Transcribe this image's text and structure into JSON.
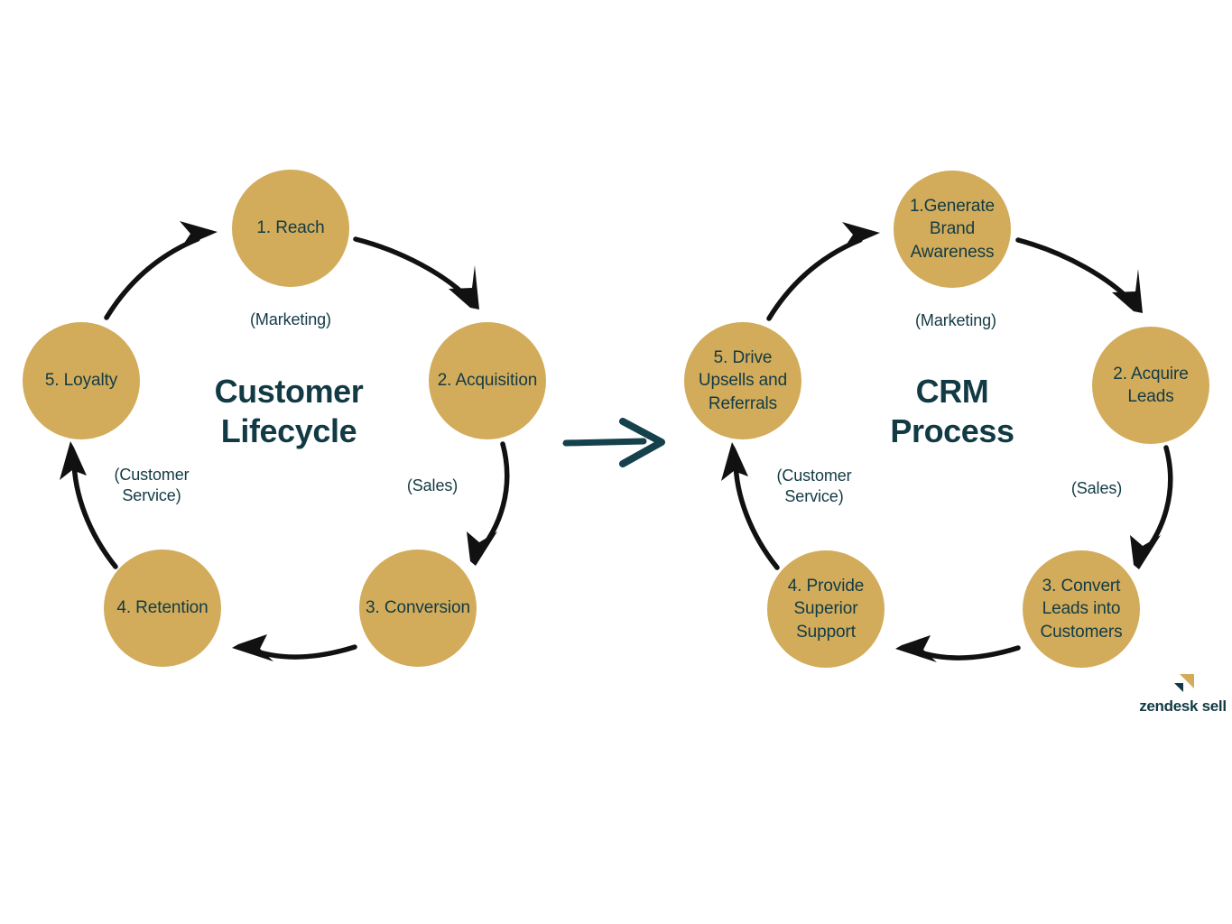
{
  "diagrams": [
    {
      "id": "customer-lifecycle",
      "title": "Customer\nLifecycle",
      "title_line1": "Customer",
      "title_line2": "Lifecycle",
      "nodes": [
        {
          "label": "1. Reach",
          "multiline": false
        },
        {
          "label": "2. Acquisition",
          "multiline": false
        },
        {
          "label": "3. Conversion",
          "multiline": false
        },
        {
          "label": "4. Retention",
          "multiline": false
        },
        {
          "label": "5. Loyalty",
          "multiline": false
        }
      ],
      "dept_labels": [
        {
          "text": "(Marketing)"
        },
        {
          "text": "(Sales)"
        },
        {
          "text": "(Customer\nService)",
          "line1": "(Customer",
          "line2": "Service)"
        }
      ]
    },
    {
      "id": "crm-process",
      "title": "CRM\nProcess",
      "title_line1": "CRM",
      "title_line2": "Process",
      "nodes": [
        {
          "label": "1.Generate Brand Awareness",
          "multiline": true
        },
        {
          "label": "2. Acquire Leads",
          "multiline": true
        },
        {
          "label": "3. Convert Leads into Customers",
          "multiline": true
        },
        {
          "label": "4. Provide Superior Support",
          "multiline": true
        },
        {
          "label": "5. Drive Upsells and Referrals",
          "multiline": true
        }
      ],
      "dept_labels": [
        {
          "text": "(Marketing)"
        },
        {
          "text": "(Sales)"
        },
        {
          "text": "(Customer\nService)",
          "line1": "(Customer",
          "line2": "Service)"
        }
      ]
    }
  ],
  "transition_arrow": {
    "name": "right-arrow",
    "direction": "right"
  },
  "logo": {
    "text": "zendesk sell",
    "mark": "zendesk-triangle-icon"
  },
  "colors": {
    "circle_fill": "#D2AC5B",
    "text_dark": "#123A44",
    "arrow_black": "#111111",
    "arrow_teal": "#14414C",
    "background": "#FFFFFF"
  }
}
